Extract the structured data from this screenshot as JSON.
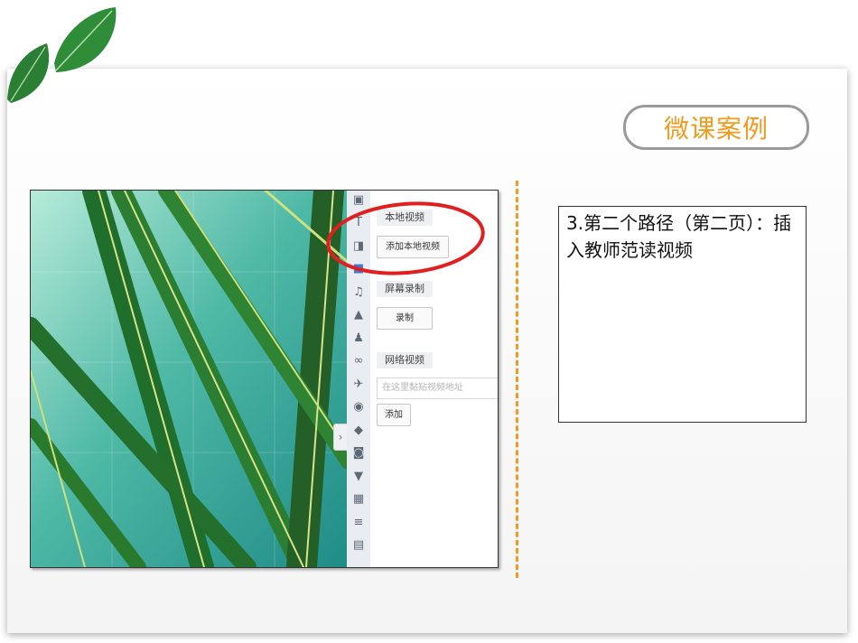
{
  "slide": {
    "title": "微课案例",
    "note": "3.第二个路径（第二页）：插入教师范读视频"
  },
  "colors": {
    "accent": "#f39a1e",
    "ellipse": "#e02020"
  },
  "screenshot": {
    "rail_icons": [
      "image-icon",
      "text-icon",
      "window-icon",
      "square-icon",
      "music-icon",
      "chart-icon",
      "people-icon",
      "link-icon",
      "plane-icon",
      "compass-icon",
      "hat-icon",
      "camera-icon",
      "shirt-icon",
      "grid-icon",
      "layers-icon",
      "tray-icon"
    ],
    "collapse_arrow": "chevron-right-icon",
    "sections": {
      "local_video": {
        "heading": "本地视频",
        "button": "添加本地视频"
      },
      "screen_record": {
        "heading": "屏幕录制",
        "button": "录制"
      },
      "web_video": {
        "heading": "网络视频",
        "placeholder": "在这里黏贴视频地址",
        "button": "添加"
      }
    }
  }
}
